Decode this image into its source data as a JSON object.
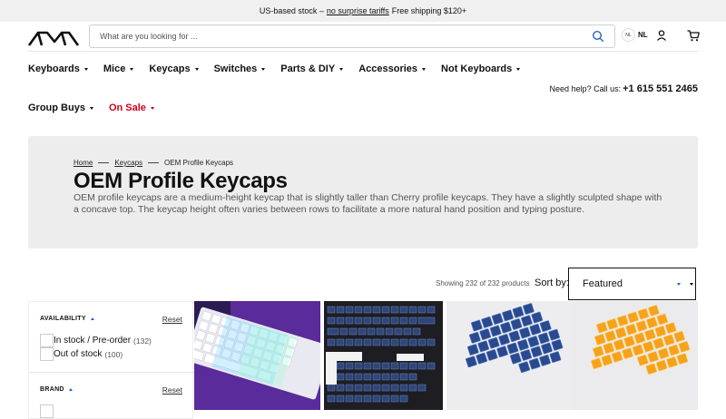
{
  "announcement": {
    "text_before": "US-based stock –",
    "link": "no surprise tariffs",
    "text_after": "Free shipping $120+"
  },
  "header": {
    "logo_name": "MK logo",
    "search_placeholder": "What are you looking for ...",
    "lang_badge": "NL",
    "lang_label": "NL"
  },
  "nav": {
    "primary": [
      {
        "label": "Keyboards"
      },
      {
        "label": "Mice"
      },
      {
        "label": "Keycaps"
      },
      {
        "label": "Switches"
      },
      {
        "label": "Parts & DIY"
      },
      {
        "label": "Accessories"
      },
      {
        "label": "Not Keyboards"
      }
    ],
    "secondary": [
      {
        "label": "Group Buys"
      },
      {
        "label": "On Sale"
      }
    ],
    "sale_color": "#d0021b"
  },
  "help": {
    "text": "Need help? Call us:",
    "phone": "+1 615 551 2465"
  },
  "hero": {
    "breadcrumb": [
      "Home",
      "Keycaps",
      "OEM Profile Keycaps"
    ],
    "title": "OEM Profile Keycaps",
    "description": "OEM profile keycaps are a medium-height keycap that is slightly taller than Cherry profile keycaps. They have a slightly sculpted shape with a concave top. The keycap height often varies between rows to facilitate a more natural hand position and typing posture."
  },
  "listing": {
    "results_text": "Showing 232 of 232 products",
    "sort_label": "Sort by:",
    "sort_value": "Featured"
  },
  "filters": {
    "availability": {
      "title": "AVAILABILITY",
      "reset": "Reset",
      "options": [
        {
          "label": "In stock / Pre-order",
          "count": "(132)"
        },
        {
          "label": "Out of stock",
          "count": "(100)"
        }
      ]
    },
    "brand": {
      "title": "BRAND",
      "reset": "Reset"
    }
  },
  "products": [
    {
      "alt": "white RGB keyboard on purple"
    },
    {
      "alt": "navy keycap set on black"
    },
    {
      "alt": "navy keycap tray"
    },
    {
      "alt": "orange keycap tray"
    }
  ],
  "colors": {
    "accent_blue": "#2563c9",
    "sale_red": "#d0021b",
    "hero_bg": "#ededed"
  }
}
